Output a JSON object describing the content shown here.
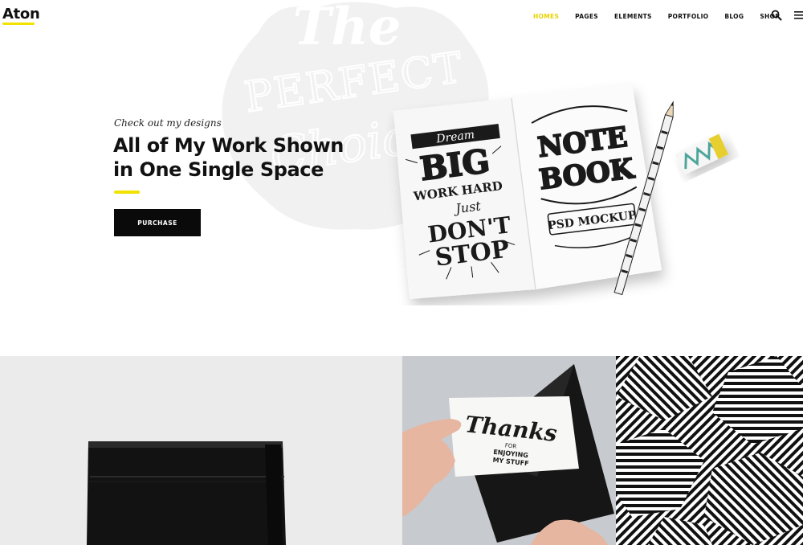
{
  "header": {
    "logo": "Aton",
    "nav": [
      "HOMES",
      "PAGES",
      "ELEMENTS",
      "PORTFOLIO",
      "BLOG",
      "SHOP"
    ],
    "active_index": 0,
    "accent_color": "#f2e200"
  },
  "hero": {
    "subtitle": "Check out my designs",
    "title_line1": "All of My Work Shown",
    "title_line2": "in One Single Space",
    "button_label": "PURCHASE",
    "watermark": {
      "line1": "The",
      "line2": "PERFECT",
      "line3": "Choice"
    }
  },
  "notebook": {
    "left_page": {
      "line1": "Dream",
      "line2": "BIG",
      "line3": "WORK",
      "line4": "HARD",
      "line5": "Just",
      "line6": "DON'T",
      "line7": "STOP"
    },
    "right_page": {
      "line1": "NOTE",
      "line2": "BOOK",
      "line3": "PSD MOCKUP"
    }
  },
  "tiles": {
    "card_text": {
      "line1": "Thanks",
      "line2": "FOR",
      "line3": "ENJOYING",
      "line4": "MY STUFF"
    }
  },
  "icons": [
    "search-icon",
    "menu-icon"
  ]
}
